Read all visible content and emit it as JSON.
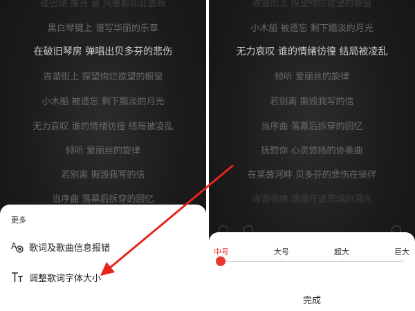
{
  "left_lyrics": [
    "碰巴刚 推开 窗 风景都如此委婉",
    "黑白琴键上 谱写华丽的乐章",
    "在破旧琴房 弹唱出贝多芬的悲伤",
    "诙谐街上 探望绚烂欲望的橱窗",
    "小木船 被遗忘 剩下黯淡的月光",
    "无力哀叹 谁的情绪彷徨 结局被凌乱",
    "倾听 爱丽丝的旋律",
    "若别离 撕毁我写的信",
    "当序曲 落幕后拆穿的回忆"
  ],
  "right_lyrics": [
    "诙谐街上 探望绚烂欲望的橱窗",
    "小木船 被遗忘 剩下黯淡的月光",
    "无力哀叹 谁的情绪彷徨 结局被凌乱",
    "倾听 爱丽丝的旋律",
    "若别离 撕毁我写的信",
    "当序曲 落幕后拆穿的回忆",
    "抚慰你 心灵悠扬的协奏曲",
    "在莱茵河畔 贝多芬的悲伤在徜徉",
    "诙谐夜晚 遗留在波恩城的泪光"
  ],
  "menu": {
    "title": "更多",
    "items": [
      {
        "label": "歌词及歌曲信息报错",
        "icon": "lyrics-report-icon"
      },
      {
        "label": "调整歌词字体大小",
        "icon": "font-size-icon"
      }
    ]
  },
  "font_size": {
    "options": [
      "中号",
      "大号",
      "超大",
      "巨大"
    ],
    "selected": "中号",
    "selected_index": 0,
    "done_label": "完成"
  },
  "colors": {
    "accent": "#e8372d",
    "arrow": "#e8231a"
  }
}
